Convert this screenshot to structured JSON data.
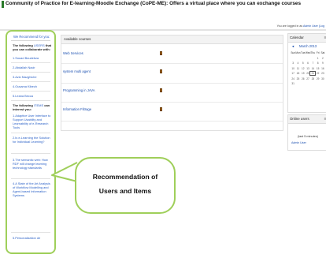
{
  "header": {
    "title": "Community of Practice for E-learning-Moodle Exchange (CoPE-ME): Offers a virtual place where you can exchange courses",
    "login_text": "You are logged in as",
    "login_link": "Admin User (Log"
  },
  "sidebar": {
    "title": "We Recommend for you:",
    "users_intro_1": "The following ",
    "users_intro_hl": "USERS",
    "users_intro_2": " that you can collaborate with:",
    "users": [
      "1.Souad Boudebza",
      "2.Abdallah Nacir",
      "3.Aziz Mazghiche",
      "4.Ousama Kibech",
      "5.Leana Becca"
    ],
    "items_intro_1": "The following ",
    "items_intro_hl": "ITEMS",
    "items_intro_2": " can interest you:",
    "items": [
      "1.Adaptive User Interface to Support Usability and Learnability of e-Research Tools",
      "2.Is e-Learning the Solution for Individual Learning?",
      "3.The semantic web: How RDF will change learning technology standards",
      "4.A State of the Art Analysis of Workflow Modelling and Agent-based Information Systems",
      "5.Personalization de"
    ]
  },
  "courses": {
    "title": "Available courses",
    "list": [
      "Web Services",
      "system multi agent",
      "Programming in JAVA",
      "Information Filtrage"
    ]
  },
  "calendar": {
    "title": "Calendar",
    "ctrl": "≡",
    "nav_prev": "◄",
    "month": "March 2013",
    "weekdays": [
      "Sun",
      "Mon",
      "Tue",
      "Wed",
      "Thu",
      "Fri",
      "Sat"
    ],
    "days": [
      "",
      "",
      "",
      "",
      "",
      "1",
      "2",
      "3",
      "4",
      "5",
      "6",
      "7",
      "8",
      "9",
      "10",
      "11",
      "12",
      "13",
      "14",
      "15",
      "16",
      "17",
      "18",
      "19",
      "20",
      "21",
      "22",
      "23",
      "24",
      "25",
      "26",
      "27",
      "28",
      "29",
      "30",
      "31",
      "",
      "",
      "",
      "",
      "",
      ""
    ],
    "today": "21"
  },
  "online": {
    "title": "Online users",
    "ctrl": "≡",
    "note": "(last 5 minutes)",
    "user": "Admin User"
  },
  "callout": {
    "line1": "Recommendation of",
    "line2": "Users and Items"
  },
  "colors": {
    "callout_border": "#9fcf5a",
    "link": "#1a4fb0"
  }
}
